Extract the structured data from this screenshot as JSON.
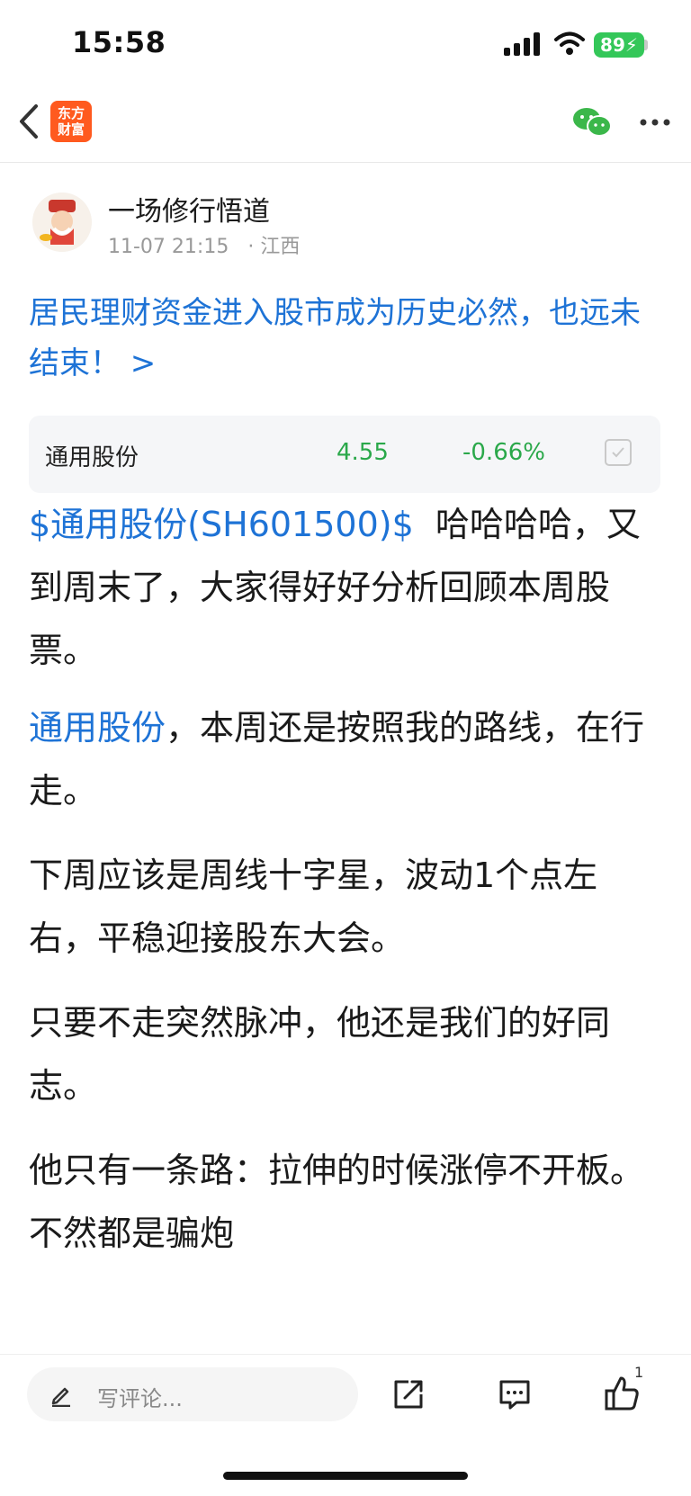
{
  "status_bar": {
    "time": "15:58",
    "battery": "89"
  },
  "nav": {
    "logo_line1": "东方",
    "logo_line2": "财富"
  },
  "author": {
    "name": "一场修行悟道",
    "timestamp": "11-07 21:15",
    "location": "· 江西"
  },
  "headline": "居民理财资金进入股市成为历史必然，也远未结束！ >",
  "stock_card": {
    "name": "通用股份",
    "price": "4.55",
    "change": "-0.66%"
  },
  "paragraphs": {
    "p1_link": "$通用股份(SH601500)$",
    "p1_text": "  哈哈哈哈，又到周末了，大家得好好分析回顾本周股票。",
    "p2_link": "通用股份",
    "p2_text": "，本周还是按照我的路线，在行走。",
    "p3": "下周应该是周线十字星，波动1个点左右，平稳迎接股东大会。",
    "p4": "只要不走突然脉冲，他还是我们的好同志。",
    "p5": "他只有一条路：拉伸的时候涨停不开板。不然都是骗炮"
  },
  "bottom_bar": {
    "comment_placeholder": "写评论...",
    "like_count": "1"
  },
  "colors": {
    "link": "#1e73d6",
    "down": "#2aa84a",
    "brand": "#ff5a1f",
    "battery": "#34c759"
  }
}
